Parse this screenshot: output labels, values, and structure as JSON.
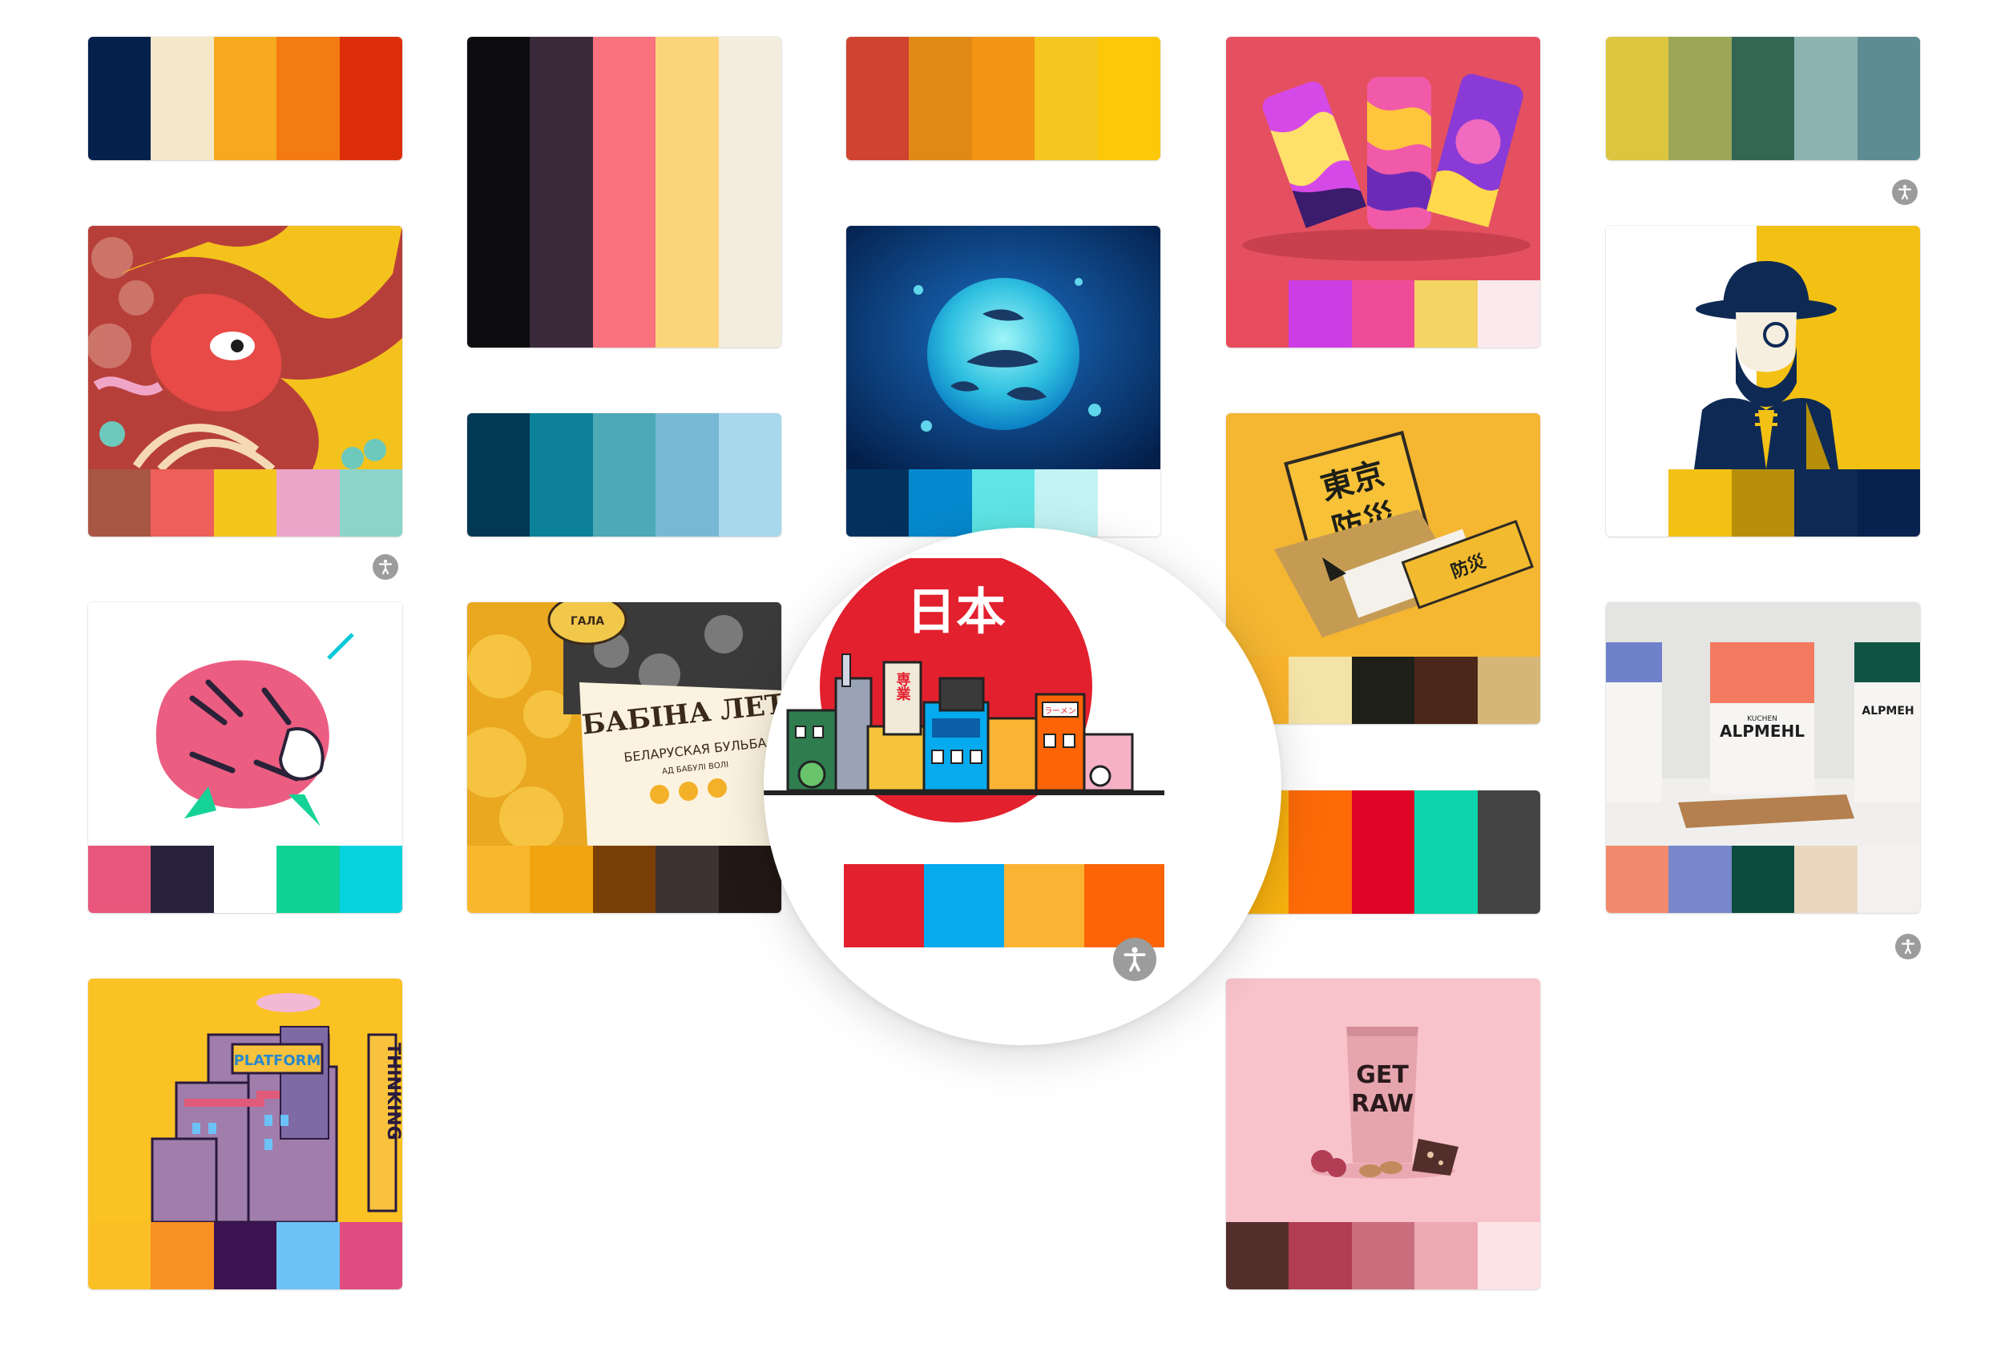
{
  "gallery": {
    "cards": [
      {
        "id": "c1",
        "kind": "palette",
        "colors": [
          "#03214a",
          "#f3e8c8",
          "#f6a81f",
          "#f47a12",
          "#dd2e0b"
        ]
      },
      {
        "id": "c2",
        "kind": "image",
        "subject": "dragon illustration",
        "colors": [
          "#a85644",
          "#ec5f5a",
          "#f4c51d",
          "#eaa5c9",
          "#8cd4c9"
        ]
      },
      {
        "id": "c3",
        "kind": "image",
        "subject": "tiger illustration",
        "colors": [
          "#e8577b",
          "#28213b",
          "#ffffff",
          "#10d295",
          "#06d3de"
        ]
      },
      {
        "id": "c4",
        "kind": "image",
        "subject": "platform thinking illustration",
        "image_text": "PLATFORM THINKING",
        "colors": [
          "#f9bf24",
          "#f89123",
          "#3b1351",
          "#6cc1f7",
          "#e04b80"
        ]
      },
      {
        "id": "c5",
        "kind": "palette",
        "colors": [
          "#0c0b0f",
          "#3b2a3b",
          "#f8737e",
          "#fcd579",
          "#f3ede0"
        ]
      },
      {
        "id": "c6",
        "kind": "palette",
        "colors": [
          "#023852",
          "#0c8199",
          "#4ca9b5",
          "#77b9d4",
          "#a8d8ec"
        ]
      },
      {
        "id": "c7",
        "kind": "image",
        "subject": "potato packaging",
        "image_text": [
          "ГАЛА",
          "БАБІНА ЛЕТА",
          "БЕЛАРУСКАЯ БУЛЬБА",
          "АД БАБУЛІ ВОЛІ"
        ],
        "colors": [
          "#f9b72d",
          "#f0a40f",
          "#7a3f05",
          "#3d3331",
          "#221816"
        ]
      },
      {
        "id": "c8",
        "kind": "palette",
        "colors": [
          "#cf4330",
          "#e08914",
          "#f39513",
          "#f4c622",
          "#fdc80a"
        ]
      },
      {
        "id": "c9",
        "kind": "image",
        "subject": "whale shark moon",
        "colors": [
          "#02315e",
          "#0689cf",
          "#5fe5e5",
          "#c3f4f5",
          "#ffffff"
        ]
      },
      {
        "id": "c10",
        "kind": "image",
        "subject": "beer cans",
        "colors": [
          "#e84b5c",
          "#cc3ee4",
          "#ef4b99",
          "#f4d463",
          "#faeaed"
        ]
      },
      {
        "id": "c11",
        "kind": "image",
        "subject": "Tokyo bosai book",
        "image_text": [
          "東京",
          "防災"
        ],
        "colors": [
          "#f9b42d",
          "#f4e3a7",
          "#1d1f18",
          "#4b271a",
          "#d6b678"
        ]
      },
      {
        "id": "c12",
        "kind": "palette",
        "colors": [
          "#f8b20f",
          "#fd6b07",
          "#de0527",
          "#0dd3ac",
          "#444444"
        ]
      },
      {
        "id": "c13",
        "kind": "image",
        "subject": "get raw bar",
        "image_text": [
          "GET",
          "RAW"
        ],
        "colors": [
          "#532f2c",
          "#b13e55",
          "#ca6e7d",
          "#eea9b3",
          "#fde3e5"
        ]
      },
      {
        "id": "c14",
        "kind": "palette",
        "colors": [
          "#dcc63f",
          "#9ba757",
          "#336754",
          "#8cb3b2",
          "#5d8c92"
        ]
      },
      {
        "id": "c15",
        "kind": "image",
        "subject": "bearded man portrait",
        "colors": [
          "#ffffff",
          "#f3c114",
          "#b78f0a",
          "#0e2a54",
          "#07224f"
        ]
      },
      {
        "id": "c16",
        "kind": "image",
        "subject": "flour bags",
        "image_text": [
          "KUCHEN",
          "ALPMEHL",
          "ALPMEH"
        ],
        "colors": [
          "#f38a6e",
          "#7787c9",
          "#0c4c3f",
          "#ebd7bd",
          "#f2f1f0"
        ]
      }
    ],
    "zoomed_card": {
      "subject": "Japan city illustration",
      "heading": "日本",
      "sign_vertical": "専業",
      "sign_small": "ラーメン",
      "colors": [
        "#ffffff",
        "#e3202e",
        "#06aaee",
        "#fbb333",
        "#fc6406"
      ]
    },
    "accessibility_icon": "accessibility-icon"
  }
}
